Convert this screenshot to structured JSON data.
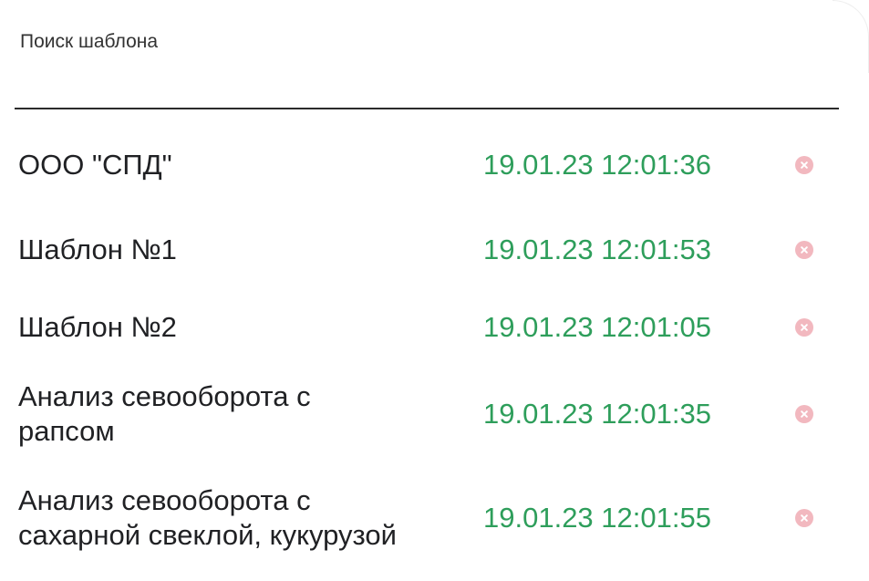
{
  "search": {
    "label": "Поиск шаблона",
    "value": "",
    "placeholder": ""
  },
  "templates": [
    {
      "name": "ООО \"СПД\"",
      "date": "19.01.23 12:01:36",
      "delete_icon": "close-circle-icon"
    },
    {
      "name": "Шаблон №1",
      "date": "19.01.23 12:01:53",
      "delete_icon": "close-circle-icon"
    },
    {
      "name": "Шаблон №2",
      "date": "19.01.23 12:01:05",
      "delete_icon": "close-circle-icon"
    },
    {
      "name": "Анализ севооборота с рапсом",
      "date": "19.01.23 12:01:35",
      "delete_icon": "close-circle-icon"
    },
    {
      "name": "Анализ севооборота с сахарной свеклой, кукурузой",
      "date": "19.01.23 12:01:55",
      "delete_icon": "close-circle-icon"
    }
  ],
  "colors": {
    "date_text": "#2e9e5b",
    "delete_icon": "#f2b8bf",
    "underline": "#2b2b2b"
  }
}
